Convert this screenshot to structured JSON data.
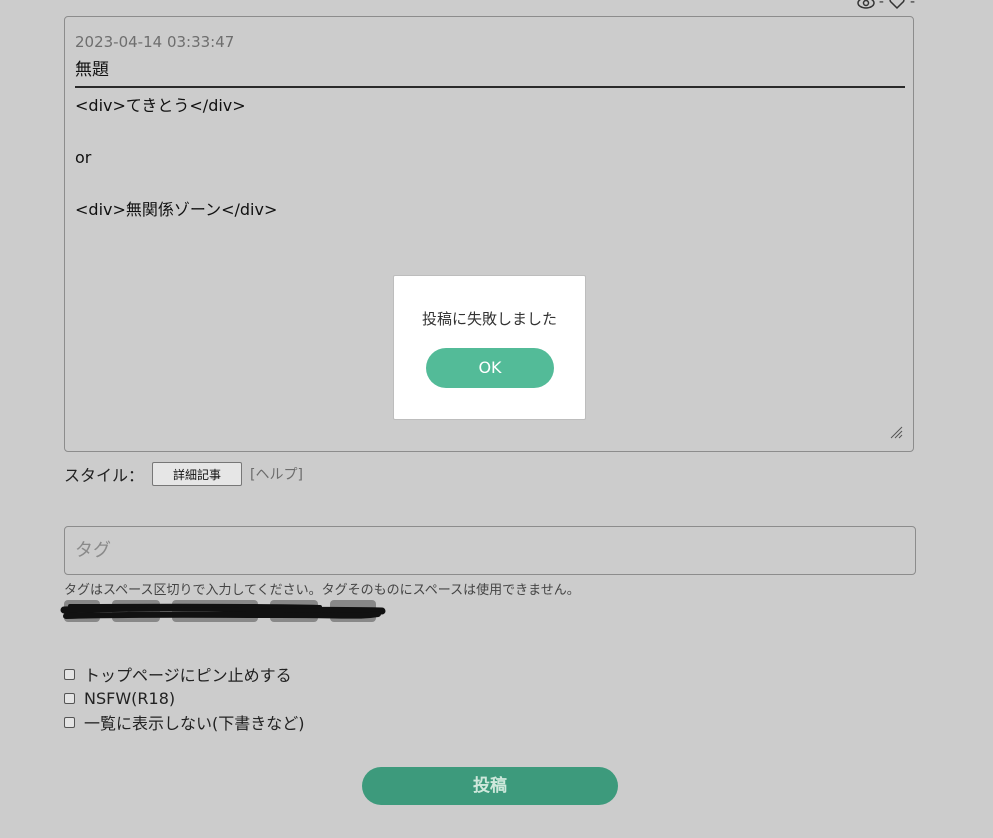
{
  "stats": {
    "views": "-",
    "likes": "-",
    "view_icon": "eye-icon",
    "like_icon": "heart-icon"
  },
  "post": {
    "date": "2023-04-14 03:33:47",
    "title": "無題",
    "body_lines": [
      "<div>てきとう</div>",
      "",
      "or",
      "",
      "<div>無関係ゾーン</div>"
    ]
  },
  "style": {
    "label": "スタイル：",
    "value": "詳細記事",
    "help": "[ヘルプ]"
  },
  "tags": {
    "placeholder": "タグ",
    "hint": "タグはスペース区切りで入力してください。タグそのものにスペースは使用できません。"
  },
  "options": [
    {
      "label": "トップページにピン止めする",
      "checked": false
    },
    {
      "label": "NSFW(R18)",
      "checked": false
    },
    {
      "label": "一覧に表示しない(下書きなど)",
      "checked": false
    }
  ],
  "submit_label": "投稿",
  "dialog": {
    "message": "投稿に失敗しました",
    "ok_label": "OK"
  },
  "colors": {
    "background": "#cccccc",
    "submit": "#3d9a7c",
    "dialog_ok": "#53bb98"
  }
}
